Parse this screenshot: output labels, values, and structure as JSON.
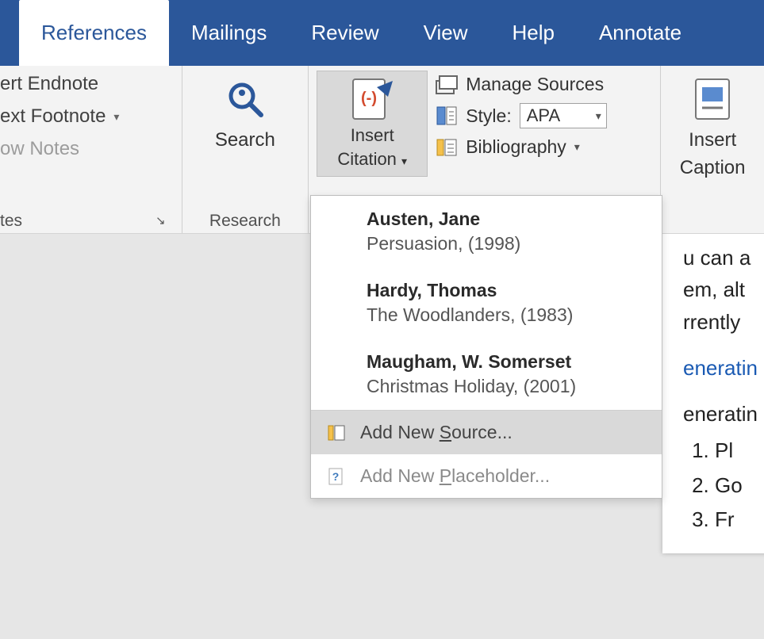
{
  "tabs": {
    "references": "References",
    "mailings": "Mailings",
    "review": "Review",
    "view": "View",
    "help": "Help",
    "annotate": "Annotate"
  },
  "footnotes": {
    "insert_endnote": "ert Endnote",
    "next_footnote": "ext Footnote",
    "show_notes": "ow Notes",
    "group_label": "tes"
  },
  "research": {
    "search": "Search",
    "group_label": "Research"
  },
  "citations": {
    "insert_citation_line1": "Insert",
    "insert_citation_line2": "Citation",
    "manage_sources": "Manage Sources",
    "style_label": "Style:",
    "style_value": "APA",
    "bibliography": "Bibliography"
  },
  "captions": {
    "line1": "Insert",
    "line2": "Caption"
  },
  "citation_menu": {
    "sources": [
      {
        "author": "Austen, Jane",
        "title": "Persuasion, (1998)"
      },
      {
        "author": "Hardy, Thomas",
        "title": "The Woodlanders, (1983)"
      },
      {
        "author": "Maugham, W. Somerset",
        "title": "Christmas Holiday, (2001)"
      }
    ],
    "add_new_source_pre": "Add New ",
    "add_new_source_key": "S",
    "add_new_source_post": "ource...",
    "add_new_placeholder_pre": "Add New ",
    "add_new_placeholder_key": "P",
    "add_new_placeholder_post": "laceholder..."
  },
  "document": {
    "para1_a": "u can a",
    "para1_b": "em, alt",
    "para1_c": "rrently",
    "link_text": "eneratin",
    "para2": "eneratin",
    "list": [
      "Pl",
      "Go",
      "Fr"
    ]
  }
}
